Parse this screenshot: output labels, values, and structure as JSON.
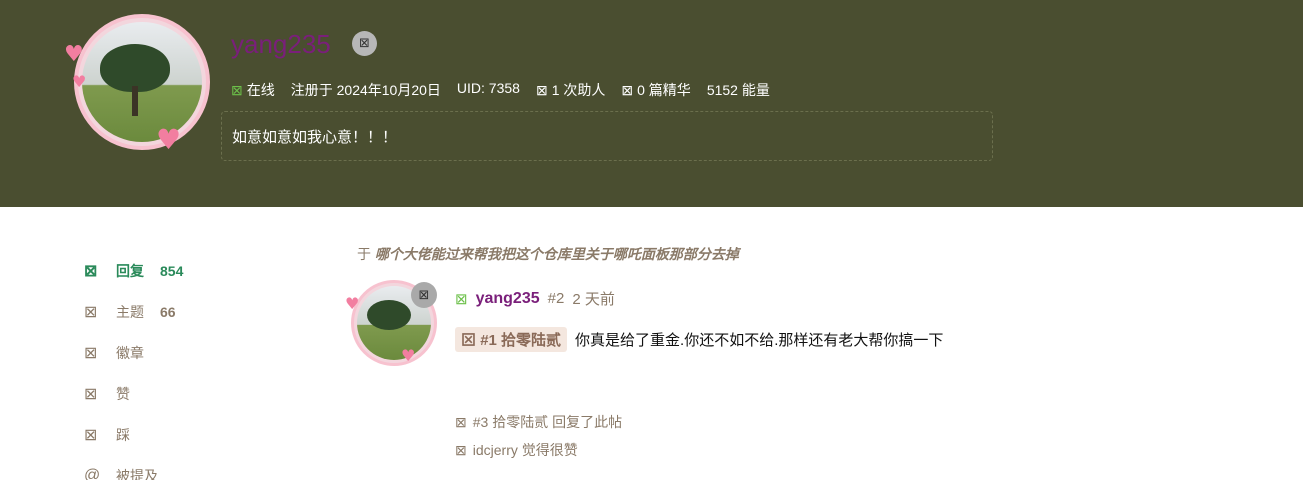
{
  "profile": {
    "username": "yang235",
    "badge_icon": "⊠",
    "online_label": "在线",
    "registered": "注册于 2024年10月20日",
    "uid": "UID: 7358",
    "helped": "1 次助人",
    "featured": "0 篇精华",
    "energy": "5152 能量",
    "bio": "如意如意如我心意！！！"
  },
  "sidebar": {
    "items": [
      {
        "label": "回复",
        "count": "854",
        "icon": "reply-icon"
      },
      {
        "label": "主题",
        "count": "66",
        "icon": "topic-icon"
      },
      {
        "label": "徽章",
        "count": "",
        "icon": "badge-icon"
      },
      {
        "label": "赞",
        "count": "",
        "icon": "like-icon"
      },
      {
        "label": "踩",
        "count": "",
        "icon": "dislike-icon"
      },
      {
        "label": "被提及",
        "count": "",
        "icon": "at-icon"
      }
    ]
  },
  "post": {
    "prefix": "于",
    "thread_title": "哪个大佬能过来帮我把这个仓库里关于哪吒面板那部分去掉",
    "author": "yang235",
    "floor": "#2",
    "time": "2 天前",
    "reply_tag": "#1 拾零陆贰",
    "content": "你真是给了重金.你还不如不给.那样还有老大帮你搞一下",
    "activity": [
      "#3 拾零陆贰 回复了此帖",
      "idcjerry 觉得很赞"
    ]
  },
  "icons": {
    "placeholder": "⊠",
    "at": "@"
  },
  "colors": {
    "hero_bg": "#4a4e30",
    "username": "#7a1f7a",
    "active": "#2a8a5a",
    "muted": "#8a7a68"
  }
}
